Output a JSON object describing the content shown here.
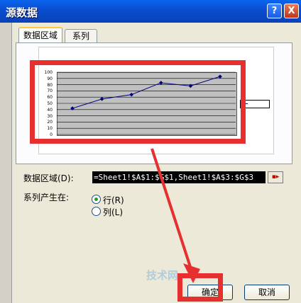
{
  "window": {
    "title": "源数据",
    "help_label": "?",
    "close_label": "X"
  },
  "tabs": [
    {
      "label": "数据区域",
      "active": true
    },
    {
      "label": "系列",
      "active": false
    }
  ],
  "chart_preview": {
    "title": "",
    "legend_label": "",
    "y_ticks": [
      "100",
      "90",
      "80",
      "70",
      "60",
      "50",
      "40",
      "30",
      "20",
      "10",
      "0"
    ],
    "chart_data": {
      "type": "line",
      "ylim": [
        0,
        100
      ],
      "series": [
        {
          "values": [
            42,
            57,
            64,
            83,
            78,
            93
          ]
        }
      ],
      "grid": true
    }
  },
  "form": {
    "range_label": "数据区域(D):",
    "range_value": "=Sheet1!$A$1:$G$1,Sheet1!$A$3:$G$3",
    "series_in_label": "系列产生在:",
    "row_option": "行(R)",
    "col_option": "列(L)",
    "selected": "row"
  },
  "buttons": {
    "ok_label": "确定",
    "cancel_label": "取消"
  },
  "watermark": "技术网",
  "colors": {
    "highlight": "#e5302f",
    "series": "#000080"
  }
}
